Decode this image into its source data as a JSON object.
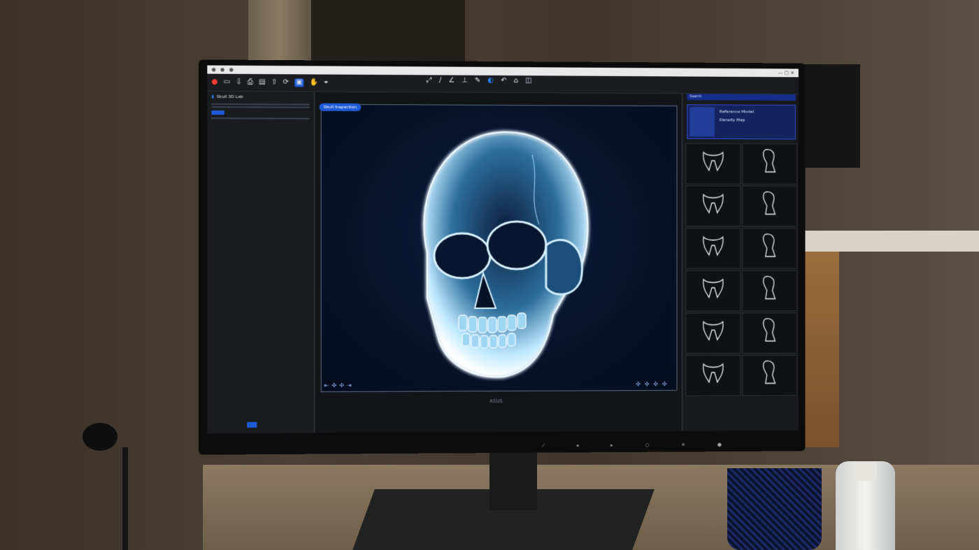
{
  "viewer": {
    "badge": "Skull Inspection",
    "brand": "ASUS",
    "toolbar": {
      "tools": [
        {
          "icon": "record-icon",
          "label": ""
        },
        {
          "icon": "square-icon",
          "label": ""
        },
        {
          "icon": "import-icon",
          "label": ""
        },
        {
          "icon": "printer-icon",
          "label": ""
        },
        {
          "icon": "layers-icon",
          "label": ""
        },
        {
          "icon": "export-icon",
          "label": ""
        },
        {
          "icon": "rotate-icon",
          "label": ""
        },
        {
          "icon": "select-icon",
          "label": ""
        },
        {
          "icon": "hand-icon",
          "label": ""
        },
        {
          "icon": "measure-icon",
          "label": ""
        }
      ]
    },
    "left_panel": {
      "title": "Skull 3D Lab"
    },
    "right_panel": {
      "search": "Search",
      "card_title": "Reference Model",
      "card_subtitle": "Density Map",
      "models": [
        {
          "label": "",
          "kind": "jaw"
        },
        {
          "label": "",
          "kind": "bone"
        },
        {
          "label": "",
          "kind": "jaw"
        },
        {
          "label": "",
          "kind": "bone"
        },
        {
          "label": "",
          "kind": "jaw"
        },
        {
          "label": "",
          "kind": "bone"
        },
        {
          "label": "",
          "kind": "jaw"
        },
        {
          "label": "",
          "kind": "bone"
        },
        {
          "label": "",
          "kind": "jaw"
        },
        {
          "label": "",
          "kind": "bone"
        },
        {
          "label": "",
          "kind": "jaw"
        },
        {
          "label": "",
          "kind": "bone"
        }
      ]
    },
    "colors": {
      "accent": "#1f5bd6",
      "xray": "#bfe9ff",
      "viewport_bg": "#07122a"
    }
  }
}
